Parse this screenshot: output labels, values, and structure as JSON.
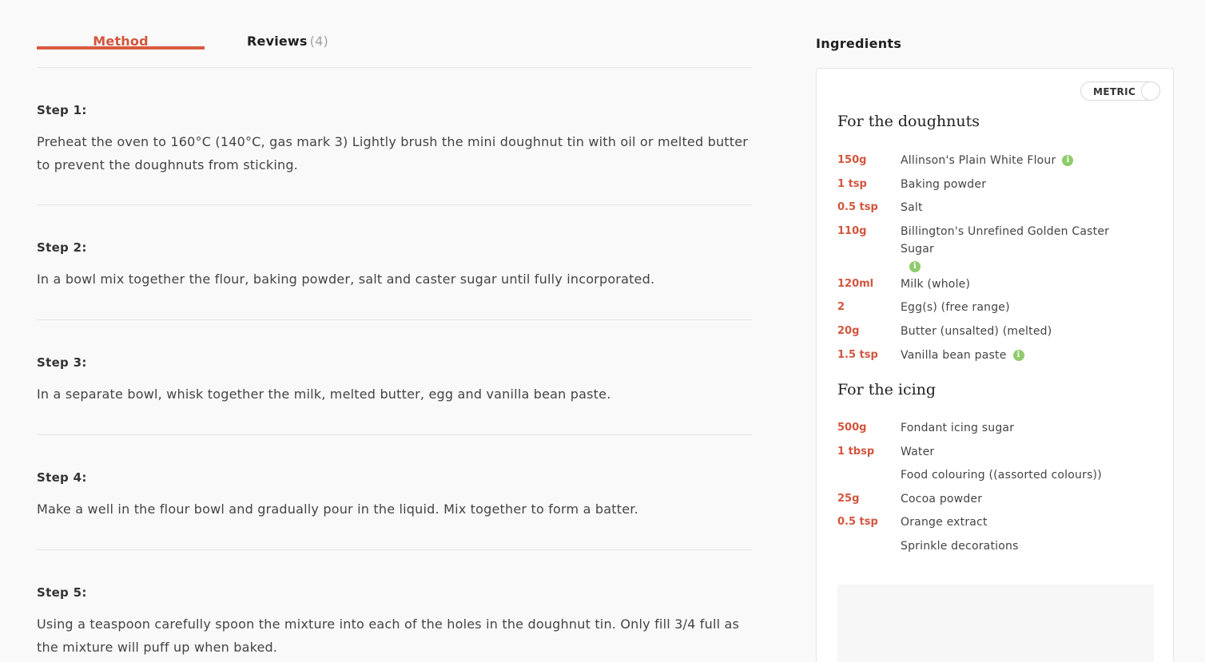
{
  "tabs": {
    "method_label": "Method",
    "reviews_label": "Reviews",
    "reviews_count": "(4)"
  },
  "steps": [
    {
      "title": "Step 1:",
      "text": "Preheat the oven to 160°C (140°C, gas mark 3) Lightly brush the mini doughnut tin with oil or melted butter to prevent the doughnuts from sticking."
    },
    {
      "title": "Step 2:",
      "text": "In a bowl mix together the flour, baking powder, salt and caster sugar until fully incorporated."
    },
    {
      "title": "Step 3:",
      "text": "In a separate bowl, whisk together the milk, melted butter, egg and vanilla bean paste."
    },
    {
      "title": "Step 4:",
      "text": "Make a well in the flour bowl and gradually pour in the liquid. Mix together to form a batter."
    },
    {
      "title": "Step 5:",
      "text": "Using a teaspoon carefully spoon the mixture into each of the holes in the doughnut tin. Only fill 3/4 full as the mixture will puff up when baked."
    }
  ],
  "ingredients": {
    "heading": "Ingredients",
    "unit_toggle_label": "METRIC",
    "info_icon_glyph": "i",
    "colors": {
      "accent": "#d95a40",
      "info": "#8ecc6b"
    },
    "groups": [
      {
        "title": "For the doughnuts",
        "items": [
          {
            "qty": "150g",
            "name": "Allinson's Plain White Flour",
            "info": true
          },
          {
            "qty": "1 tsp",
            "name": "Baking powder",
            "info": false
          },
          {
            "qty": "0.5 tsp",
            "name": "Salt",
            "info": false
          },
          {
            "qty": "110g",
            "name": "Billington's Unrefined Golden Caster Sugar",
            "info": true
          },
          {
            "qty": "120ml",
            "name": "Milk (whole)",
            "info": false
          },
          {
            "qty": "2",
            "name": "Egg(s) (free range)",
            "info": false
          },
          {
            "qty": "20g",
            "name": "Butter (unsalted) (melted)",
            "info": false
          },
          {
            "qty": "1.5 tsp",
            "name": "Vanilla bean paste",
            "info": true
          }
        ]
      },
      {
        "title": "For the icing",
        "items": [
          {
            "qty": "500g",
            "name": "Fondant icing sugar",
            "info": false
          },
          {
            "qty": "1 tbsp",
            "name": "Water",
            "info": false
          },
          {
            "qty": "",
            "name": "Food colouring ((assorted colours))",
            "info": false
          },
          {
            "qty": "25g",
            "name": "Cocoa powder",
            "info": false
          },
          {
            "qty": "0.5 tsp",
            "name": "Orange extract",
            "info": false
          },
          {
            "qty": "",
            "name": "Sprinkle decorations",
            "info": false
          }
        ]
      }
    ]
  }
}
